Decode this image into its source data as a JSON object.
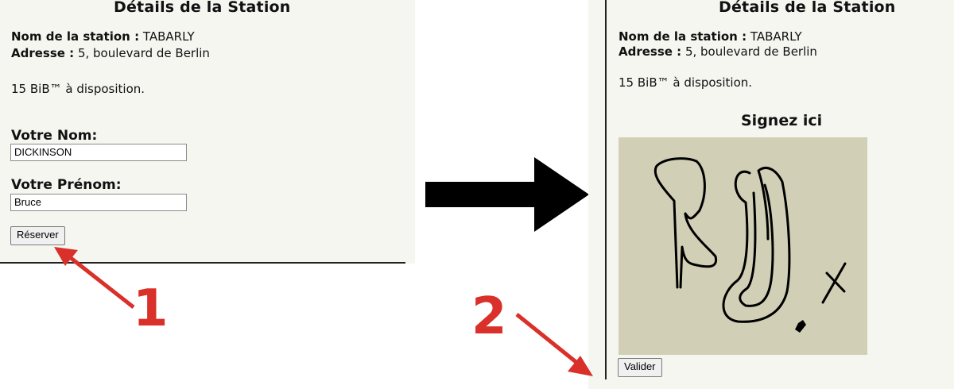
{
  "left_panel": {
    "title": "Détails de la Station",
    "station_name_label": "Nom de la station :",
    "station_name_value": "TABARLY",
    "address_label": "Adresse :",
    "address_value": "5, boulevard de Berlin",
    "availability": "15 BiB™ à disposition.",
    "last_name_label": "Votre Nom:",
    "last_name_value": "DICKINSON",
    "first_name_label": "Votre Prénom:",
    "first_name_value": "Bruce",
    "reserve_button": "Réserver"
  },
  "right_panel": {
    "title": "Détails de la Station",
    "station_name_label": "Nom de la station :",
    "station_name_value": "TABARLY",
    "address_label": "Adresse :",
    "address_value": "5, boulevard de Berlin",
    "availability": "15 BiB™ à disposition.",
    "signature_title": "Signez ici",
    "validate_button": "Valider"
  },
  "annotations": {
    "step1": "1",
    "step2": "2"
  },
  "colors": {
    "panel_bg": "#f6f6f1",
    "signature_bg": "#d1d0b6",
    "annotation_red": "#d9302a"
  }
}
